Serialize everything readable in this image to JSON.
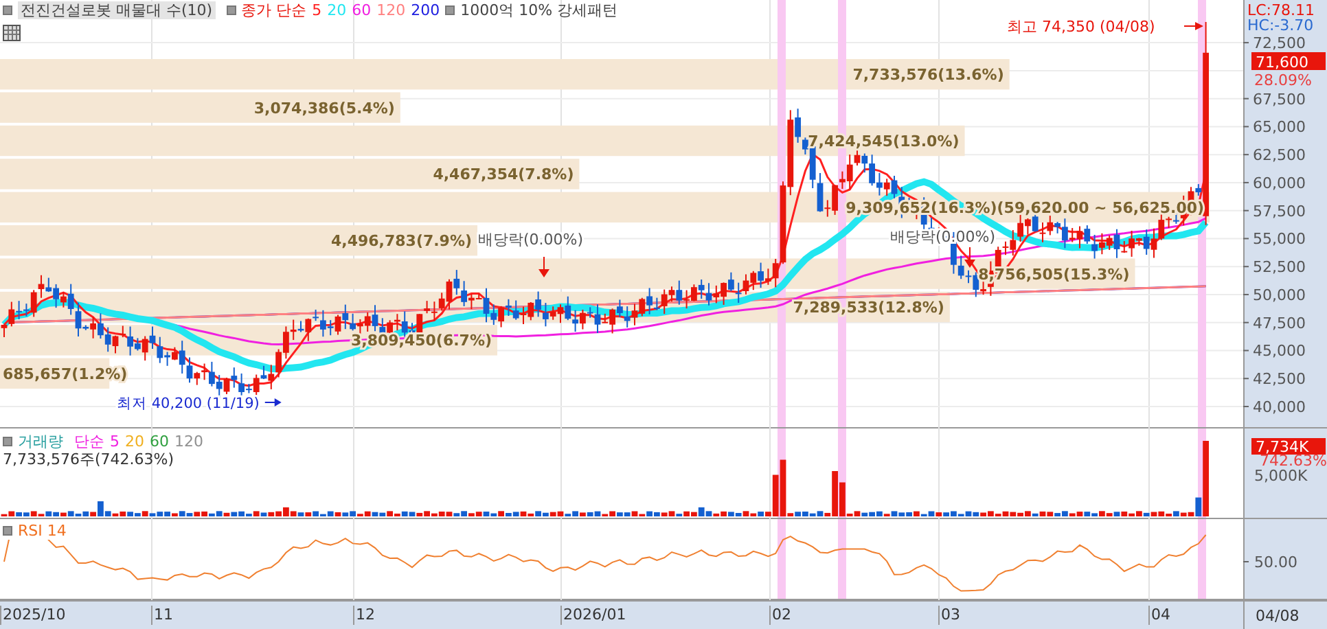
{
  "legend": {
    "title": "전진건설로봇 매물대 수(10)",
    "ma_prefix": "종가 단순",
    "ma": [
      {
        "label": "5",
        "color": "#ff2020"
      },
      {
        "label": "20",
        "color": "#22e6f0"
      },
      {
        "label": "60",
        "color": "#f020e0"
      },
      {
        "label": "120",
        "color": "#ff8080"
      },
      {
        "label": "200",
        "color": "#2020e0"
      }
    ],
    "pattern": "1000억 10% 강세패턴"
  },
  "price_panel": {
    "volume_profile": [
      {
        "label": "7,733,576(13.6%)",
        "level": 0.812
      },
      {
        "label": "3,074,386(5.4%)",
        "level": 0.322
      },
      {
        "label": "7,424,545(13.0%)",
        "level": 0.776
      },
      {
        "label": "4,467,354(7.8%)",
        "level": 0.466
      },
      {
        "label": "9,309,652(16.3%)(59,620.00 ~ 56,625.00)",
        "level": 0.973
      },
      {
        "label": "4,496,783(7.9%)",
        "level": 0.384
      },
      {
        "label": "8,756,505(15.3%)",
        "level": 0.913
      },
      {
        "label": "7,289,533(12.8%)",
        "level": 0.764
      },
      {
        "label": "3,809,450(6.7%)",
        "level": 0.4
      },
      {
        "label": "685,657(1.2%)",
        "level": 0.088
      }
    ],
    "annotations": [
      {
        "kind": "high",
        "text": "최고 74,350 (04/08)"
      },
      {
        "kind": "low",
        "text": "최저 40,200 (11/19)"
      },
      {
        "kind": "dividend",
        "text": "배당락(0.00%)"
      },
      {
        "kind": "dividend",
        "text": "배당락(0.00%)"
      }
    ],
    "axis": {
      "lc": "LC:78.11",
      "hc": "HC:-3.70",
      "ticks": [
        "72,500",
        "67,500",
        "65,000",
        "62,500",
        "60,000",
        "57,500",
        "55,000",
        "52,500",
        "50,000",
        "47,500",
        "45,000",
        "42,500",
        "40,000"
      ],
      "price_tag": "71,600",
      "change": "28.09%"
    }
  },
  "volume_panel": {
    "legend": {
      "title": "거래량",
      "ma_prefix": "단순",
      "ma": [
        {
          "label": "5",
          "color": "#f020e0"
        },
        {
          "label": "20",
          "color": "#f0b020"
        },
        {
          "label": "60",
          "color": "#30a040"
        },
        {
          "label": "120",
          "color": "#909090"
        }
      ]
    },
    "reading": "7,733,576주(742.63%)",
    "tag": "7,734K",
    "tag_change": "742.63%",
    "ticks": [
      "5,000K"
    ]
  },
  "rsi_panel": {
    "title": "RSI 14",
    "ticks": [
      "50.00"
    ]
  },
  "x_axis": {
    "labels": [
      "2025/10",
      "11",
      "12",
      "2026/01",
      "02",
      "03",
      "04"
    ],
    "last_date": "04/08"
  }
}
